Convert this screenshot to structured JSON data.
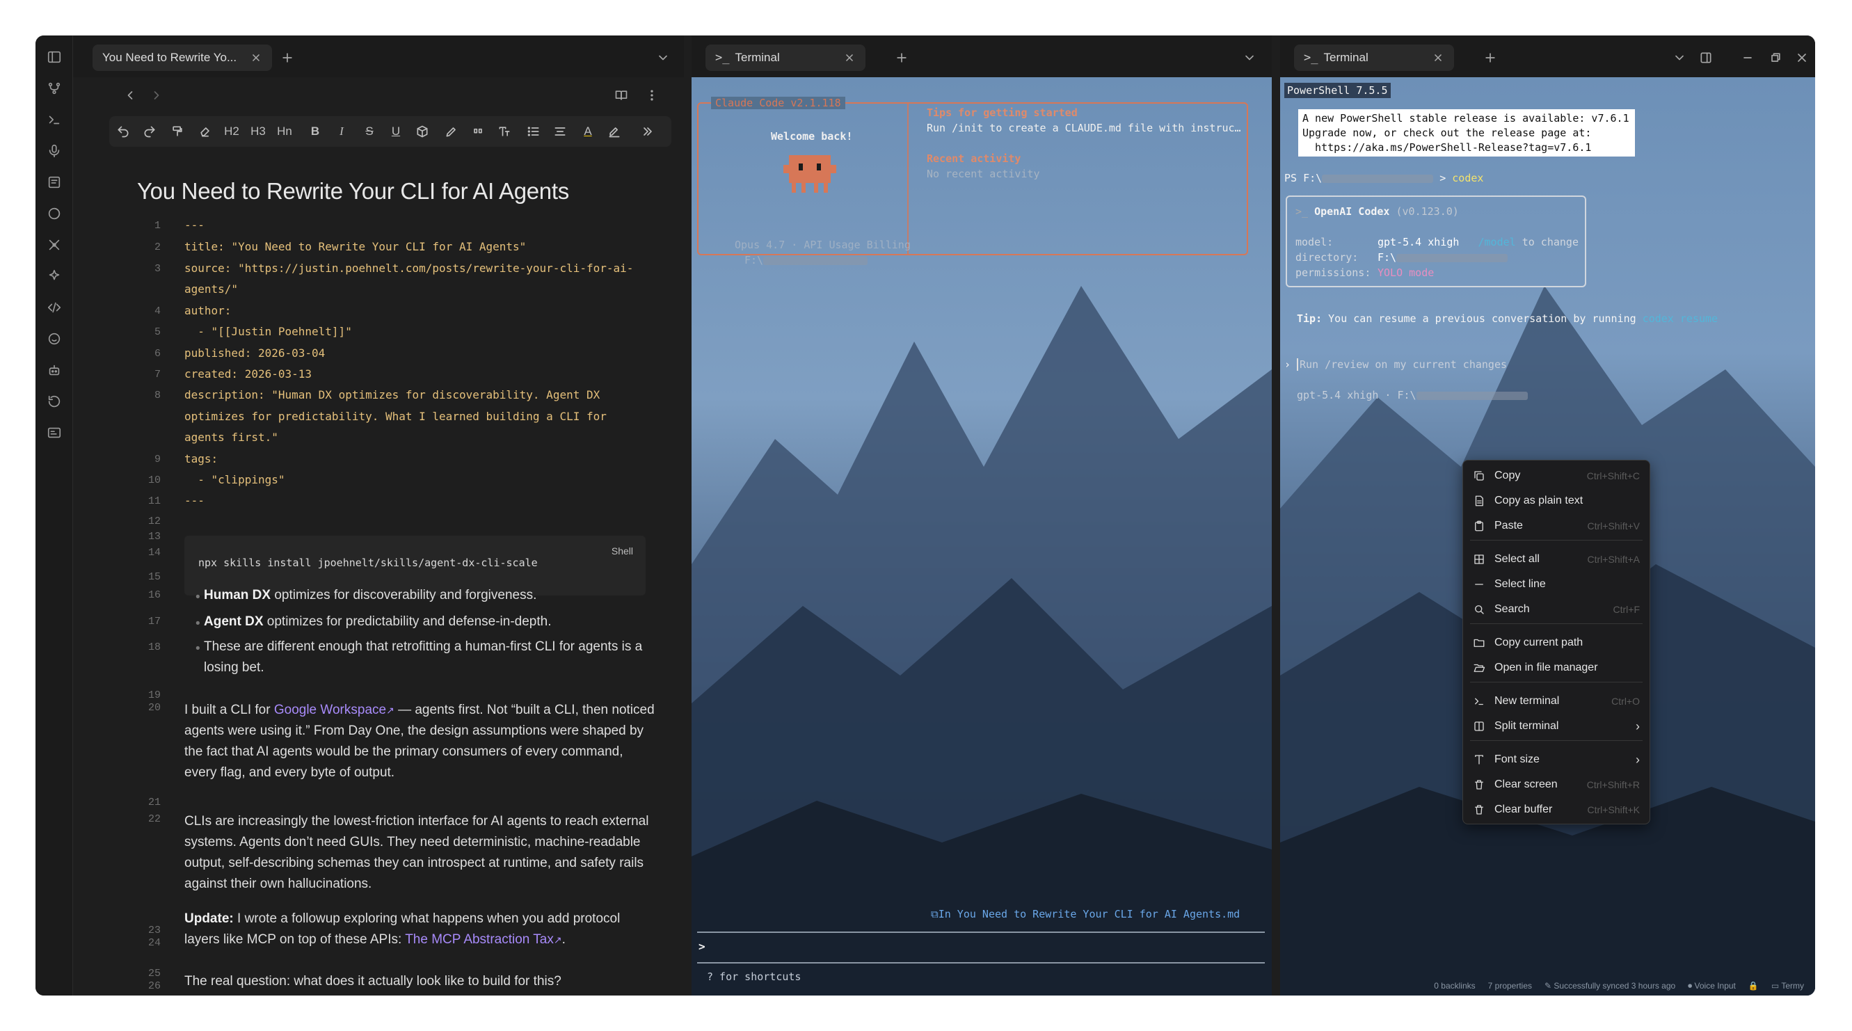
{
  "editor": {
    "tab_title": "You Need to Rewrite Yo...",
    "doc_title": "You Need to Rewrite Your CLI for AI Agents",
    "format_labels": {
      "h2": "H2",
      "h3": "H3",
      "hn": "Hn"
    },
    "frontmatter": [
      {
        "n": "1",
        "text": "---"
      },
      {
        "n": "2",
        "key": "title: ",
        "val": "\"You Need to Rewrite Your CLI for AI Agents\""
      },
      {
        "n": "3",
        "key": "source: ",
        "val": "\"https://justin.poehnelt.com/posts/rewrite-your-cli-for-ai-"
      },
      {
        "n": "",
        "text": "agents/\""
      },
      {
        "n": "4",
        "key": "author:",
        "val": ""
      },
      {
        "n": "5",
        "text": "  - \"[[Justin Poehnelt]]\""
      },
      {
        "n": "6",
        "key": "published: ",
        "val": "2026-03-04"
      },
      {
        "n": "7",
        "key": "created: ",
        "val": "2026-03-13"
      },
      {
        "n": "8",
        "key": "description: ",
        "val": "\"Human DX optimizes for discoverability. Agent DX"
      },
      {
        "n": "",
        "text": "optimizes for predictability. What I learned building a CLI for"
      },
      {
        "n": "",
        "text": "agents first.\""
      },
      {
        "n": "9",
        "key": "tags:",
        "val": ""
      },
      {
        "n": "10",
        "text": "  - \"clippings\""
      },
      {
        "n": "11",
        "text": "---"
      }
    ],
    "code_block": {
      "lang": "Shell",
      "code": "npx skills install jpoehnelt/skills/agent-dx-cli-scale"
    },
    "line_numbers_extra": [
      "12",
      "13",
      "14",
      "15",
      "16",
      "17",
      "18",
      "19",
      "20",
      "21",
      "22",
      "23",
      "24",
      "25",
      "26"
    ],
    "bullets": [
      {
        "bold": "Human DX",
        "rest": " optimizes for discoverability and forgiveness."
      },
      {
        "bold": "Agent DX",
        "rest": " optimizes for predictability and defense-in-depth."
      },
      {
        "bold": "",
        "rest": "These are different enough that retrofitting a human-first CLI for agents is a losing bet."
      }
    ],
    "para1": {
      "a": "I built a CLI for ",
      "link": "Google Workspace",
      "b": " — agents first. Not “built a CLI, then noticed agents were using it.” From Day One, the design assumptions were shaped by the fact that AI agents would be the primary consumers of every command, every flag, and every byte of output."
    },
    "para2": "CLIs are increasingly the lowest-friction interface for AI agents to reach external systems. Agents don’t need GUIs. They need deterministic, machine-readable output, self-describing schemas they can introspect at runtime, and safety rails against their own hallucinations.",
    "para3": {
      "bold": "Update:",
      "a": " I wrote a followup exploring what happens when you add protocol layers like MCP on top of these APIs: ",
      "link": "The MCP Abstraction Tax",
      "b": "."
    },
    "para4": "The real question: what does it actually look like to build for this?"
  },
  "terminal1": {
    "tab_title": "Terminal",
    "header": "Claude Code v2.1.118",
    "welcome": "Welcome back!",
    "model_line": "Opus 4.7 · API Usage Billing",
    "path": "F:\\",
    "tips_title": "Tips for getting started",
    "tips_text": "Run /init to create a CLAUDE.md file with instruc…",
    "recent_title": "Recent activity",
    "recent_text": "No recent activity",
    "context_line": "In You Need to Rewrite Your CLI for AI Agents.md",
    "prompt": ">",
    "shortcuts": "? for shortcuts"
  },
  "terminal2": {
    "tab_title": "Terminal",
    "ps_version": "PowerShell 7.5.5",
    "notice": [
      "A new PowerShell stable release is available: v7.6.1",
      "Upgrade now, or check out the release page at:",
      "  https://aka.ms/PowerShell-Release?tag=v7.6.1"
    ],
    "prompt_prefix": "PS F:\\",
    "command": "codex",
    "codex_title": "OpenAI Codex",
    "codex_version": "(v0.123.0)",
    "model_label": "model:",
    "model_value": "gpt-5.4 xhigh",
    "model_hint": "/model",
    "model_hint_tail": " to change",
    "dir_label": "directory:",
    "dir_value": "F:\\",
    "perm_label": "permissions:",
    "perm_value": "YOLO mode",
    "tip_label": "Tip:",
    "tip_text": " You can resume a previous conversation by running ",
    "tip_cmd": "codex resume",
    "input_placeholder": "Run /review on my current changes",
    "footer": "gpt-5.4 xhigh · F:\\"
  },
  "context_menu": {
    "items": [
      {
        "label": "Copy",
        "shortcut": "Ctrl+Shift+C",
        "icon": "copy-icon"
      },
      {
        "label": "Copy as plain text",
        "shortcut": "",
        "icon": "file-text-icon"
      },
      {
        "label": "Paste",
        "shortcut": "Ctrl+Shift+V",
        "icon": "clipboard-icon"
      },
      {
        "label": "Select all",
        "shortcut": "Ctrl+Shift+A",
        "icon": "grid-icon"
      },
      {
        "label": "Select line",
        "shortcut": "",
        "icon": "minus-icon"
      },
      {
        "label": "Search",
        "shortcut": "Ctrl+F",
        "icon": "search-icon"
      },
      {
        "label": "Copy current path",
        "shortcut": "",
        "icon": "folder-icon"
      },
      {
        "label": "Open in file manager",
        "shortcut": "",
        "icon": "folder-open-icon"
      },
      {
        "label": "New terminal",
        "shortcut": "Ctrl+O",
        "icon": "terminal-icon"
      },
      {
        "label": "Split terminal",
        "shortcut": "›",
        "icon": "split-icon"
      },
      {
        "label": "Font size",
        "shortcut": "›",
        "icon": "type-icon"
      },
      {
        "label": "Clear screen",
        "shortcut": "Ctrl+Shift+R",
        "icon": "trash-icon"
      },
      {
        "label": "Clear buffer",
        "shortcut": "Ctrl+Shift+K",
        "icon": "trash-icon"
      }
    ]
  },
  "status_bar": {
    "backlinks": "0 backlinks",
    "properties": "7 properties",
    "sync": "Successfully synced 3 hours ago",
    "voice": "Voice Input",
    "app": "Termy"
  }
}
